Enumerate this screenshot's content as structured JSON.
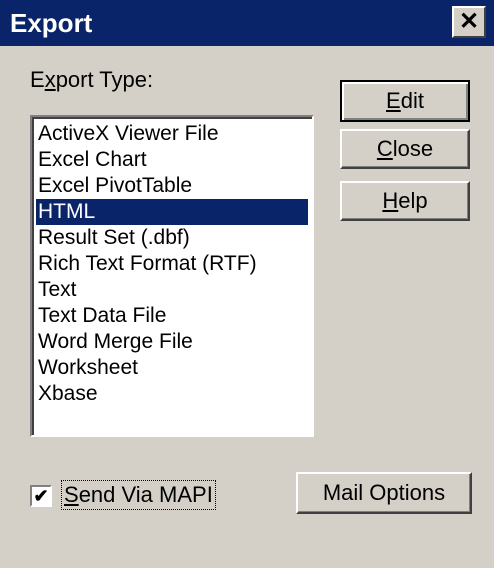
{
  "window": {
    "title": "Export",
    "close_glyph": "✕"
  },
  "export_type": {
    "label_pre": "E",
    "label_mnemonic": "x",
    "label_post": "port Type:"
  },
  "list": {
    "items": [
      "ActiveX Viewer File",
      "Excel Chart",
      "Excel PivotTable",
      "HTML",
      "Result Set (.dbf)",
      "Rich Text Format (RTF)",
      "Text",
      "Text Data File",
      "Word Merge File",
      "Worksheet",
      "Xbase"
    ],
    "selected": "HTML"
  },
  "buttons": {
    "edit": {
      "mnemonic": "E",
      "rest": "dit"
    },
    "close": {
      "mnemonic": "C",
      "rest": "lose"
    },
    "help": {
      "mnemonic": "H",
      "rest": "elp"
    },
    "mail_options": "Mail Options"
  },
  "send_mapi": {
    "checked": true,
    "check_glyph": "✔",
    "mnemonic": "S",
    "rest": "end Via MAPI"
  }
}
